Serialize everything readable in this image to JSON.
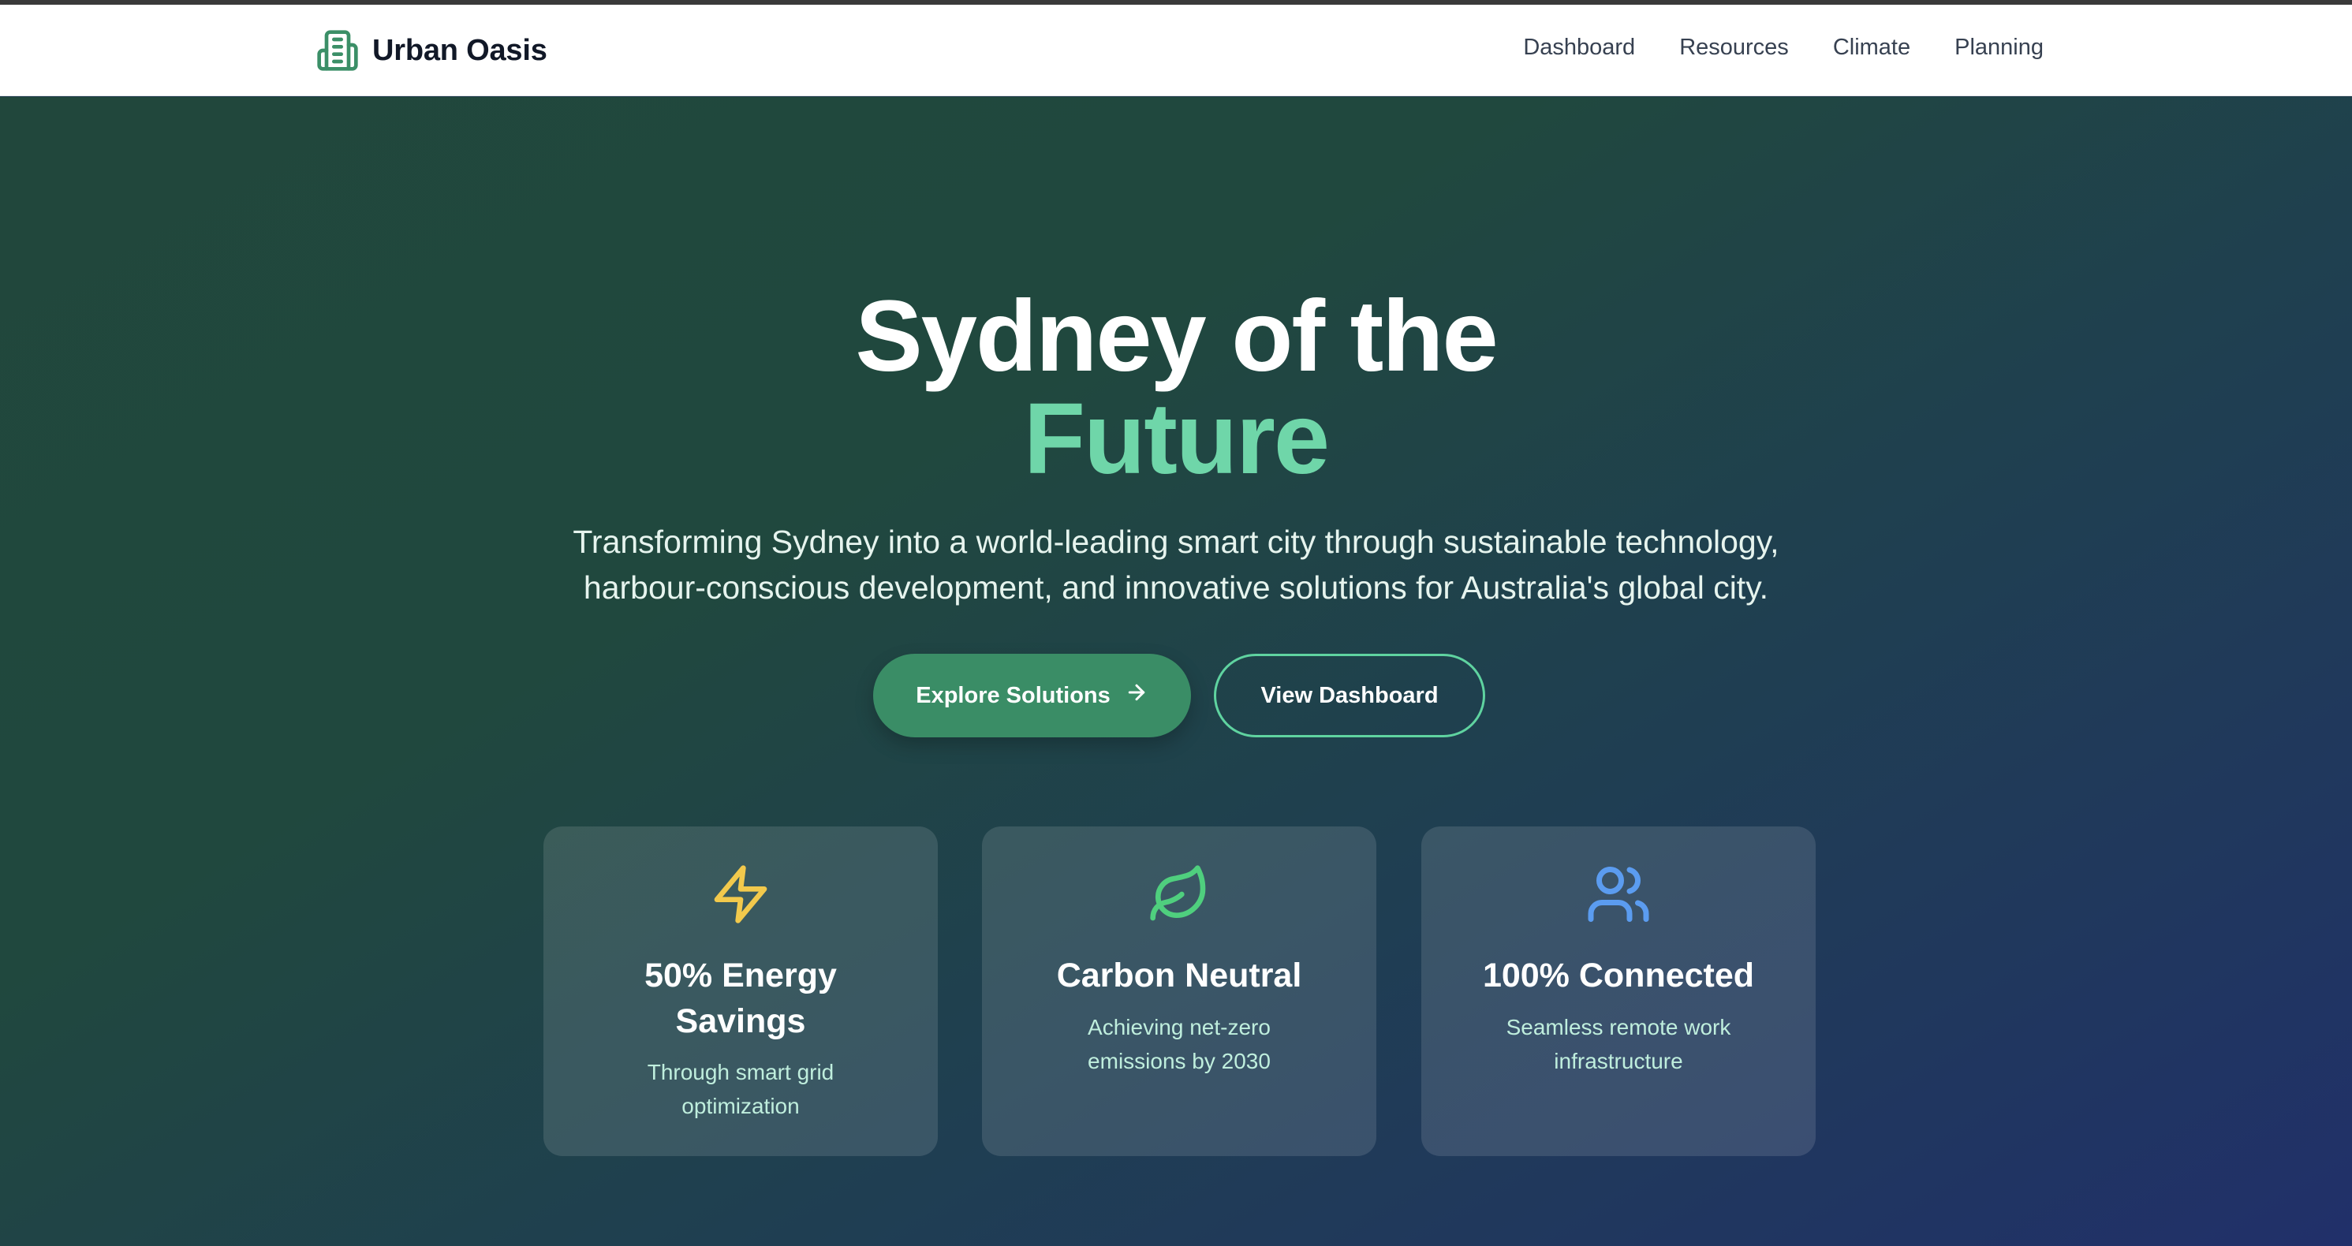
{
  "brand": {
    "name": "Urban Oasis",
    "icon": "building-icon"
  },
  "nav": {
    "items": [
      {
        "label": "Dashboard"
      },
      {
        "label": "Resources"
      },
      {
        "label": "Climate"
      },
      {
        "label": "Planning"
      }
    ]
  },
  "hero": {
    "title_line1": "Sydney of the",
    "title_line2": "Future",
    "subtitle": "Transforming Sydney into a world-leading smart city through sustainable technology, harbour-conscious development, and innovative solutions for Australia's global city.",
    "primary_button": {
      "label": "Explore Solutions",
      "icon": "arrow-right-icon"
    },
    "secondary_button": {
      "label": "View Dashboard"
    }
  },
  "cards": [
    {
      "icon": "lightning-icon",
      "icon_color": "#f2c94c",
      "title": "50% Energy Savings",
      "description": "Through smart grid optimization"
    },
    {
      "icon": "leaf-icon",
      "icon_color": "#4fcf7e",
      "title": "Carbon Neutral",
      "description": "Achieving net-zero emissions by 2030"
    },
    {
      "icon": "users-icon",
      "icon_color": "#5b9cf0",
      "title": "100% Connected",
      "description": "Seamless remote work infrastructure"
    }
  ],
  "colors": {
    "accent_green": "#6fd6a9",
    "button_green": "#3a8d66",
    "brand_green": "#3b8f67"
  }
}
